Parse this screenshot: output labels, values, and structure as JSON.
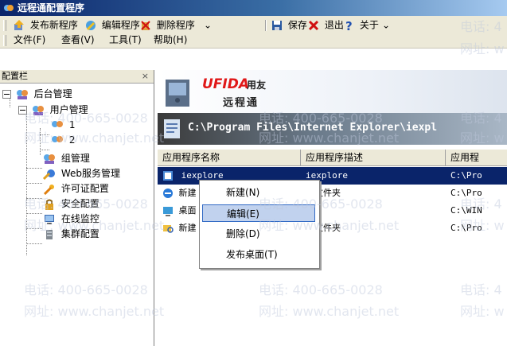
{
  "window": {
    "title": "远程通配置程序",
    "accent": "#0a246a"
  },
  "toolbar": {
    "publish_label": "发布新程序",
    "edit_label": "编辑程序",
    "delete_label": "删除程序",
    "save_label": "保存",
    "exit_label": "退出",
    "about_label": "关于"
  },
  "menu": {
    "file": "文件(F)",
    "view": "查看(V)",
    "tools": "工具(T)",
    "help": "帮助(H)"
  },
  "sidebar": {
    "header": "配置栏",
    "close": "×",
    "root": "后台管理",
    "user_mgmt": "用户管理",
    "user_1": "1",
    "user_2": "2",
    "group_mgmt": "组管理",
    "web_service": "Web服务管理",
    "license": "许可证配置",
    "security": "安全配置",
    "monitor": "在线监控",
    "cluster": "集群配置"
  },
  "banner": {
    "logo_brand": "UFIDA",
    "logo_cn": "用友",
    "logo_product": "远程通",
    "path": "C:\\Program Files\\Internet Explorer\\iexpl"
  },
  "list": {
    "columns": [
      "应用程序名称",
      "应用程序描述",
      "应用程"
    ],
    "rows": [
      {
        "name": "iexplore",
        "desc": "iexplore",
        "path": "C:\\Pro"
      },
      {
        "name": "新建",
        "desc": "建文件夹",
        "path": "C:\\Pro"
      },
      {
        "name": "桌面",
        "desc": "面",
        "path": "C:\\WIN"
      },
      {
        "name": "新建",
        "desc": "建文件夹",
        "path": "C:\\Pro"
      }
    ]
  },
  "context_menu": {
    "new": "新建(N)",
    "edit": "编辑(E)",
    "delete": "删除(D)",
    "publish_desktop": "发布桌面(T)"
  },
  "watermark": {
    "phone": "电话: 400-665-0028",
    "site": "网址: www.chanjet.net",
    "phone_short": "电话: 4",
    "site_short": "网址: w"
  }
}
